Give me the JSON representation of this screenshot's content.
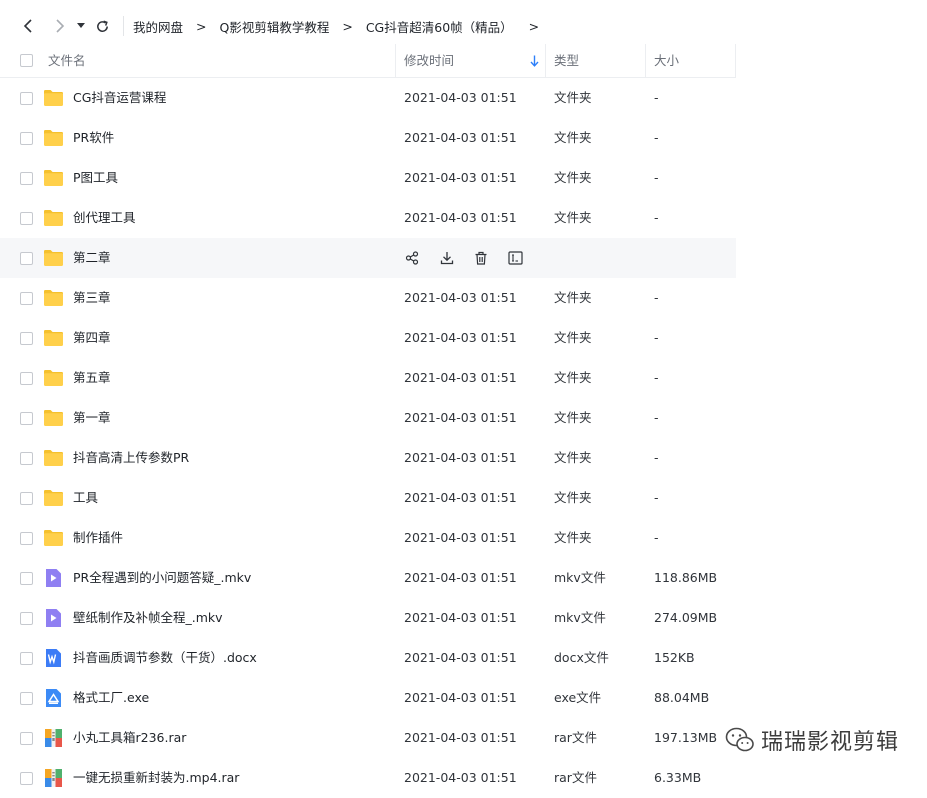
{
  "nav": {
    "back_icon": "chevron-left-icon",
    "forward_icon": "chevron-right-icon",
    "history_icon": "caret-down-icon",
    "refresh_icon": "refresh-icon"
  },
  "breadcrumb": [
    "我的网盘",
    "Q影视剪辑教学教程",
    "CG抖音超清60帧（精品）"
  ],
  "breadcrumb_separator": ">",
  "columns": {
    "name": "文件名",
    "date": "修改时间",
    "type": "类型",
    "size": "大小"
  },
  "sort": {
    "column": "date",
    "direction": "descending",
    "color": "#2d7ff9"
  },
  "files": [
    {
      "name": "CG抖音运营课程",
      "date": "2021-04-03 01:51",
      "type": "文件夹",
      "size": "-",
      "icon": "folder-icon"
    },
    {
      "name": "PR软件",
      "date": "2021-04-03 01:51",
      "type": "文件夹",
      "size": "-",
      "icon": "folder-icon"
    },
    {
      "name": "P图工具",
      "date": "2021-04-03 01:51",
      "type": "文件夹",
      "size": "-",
      "icon": "folder-icon"
    },
    {
      "name": "创代理工具",
      "date": "2021-04-03 01:51",
      "type": "文件夹",
      "size": "-",
      "icon": "folder-icon"
    },
    {
      "name": "第二章",
      "date": "",
      "type": "",
      "size": "",
      "icon": "folder-icon",
      "hover": true
    },
    {
      "name": "第三章",
      "date": "2021-04-03 01:51",
      "type": "文件夹",
      "size": "-",
      "icon": "folder-icon"
    },
    {
      "name": "第四章",
      "date": "2021-04-03 01:51",
      "type": "文件夹",
      "size": "-",
      "icon": "folder-icon"
    },
    {
      "name": "第五章",
      "date": "2021-04-03 01:51",
      "type": "文件夹",
      "size": "-",
      "icon": "folder-icon"
    },
    {
      "name": "第一章",
      "date": "2021-04-03 01:51",
      "type": "文件夹",
      "size": "-",
      "icon": "folder-icon"
    },
    {
      "name": "抖音高清上传参数PR",
      "date": "2021-04-03 01:51",
      "type": "文件夹",
      "size": "-",
      "icon": "folder-icon"
    },
    {
      "name": "工具",
      "date": "2021-04-03 01:51",
      "type": "文件夹",
      "size": "-",
      "icon": "folder-icon"
    },
    {
      "name": "制作插件",
      "date": "2021-04-03 01:51",
      "type": "文件夹",
      "size": "-",
      "icon": "folder-icon"
    },
    {
      "name": "PR全程遇到的小问题答疑_.mkv",
      "date": "2021-04-03 01:51",
      "type": "mkv文件",
      "size": "118.86MB",
      "icon": "video-file-icon"
    },
    {
      "name": "壁纸制作及补帧全程_.mkv",
      "date": "2021-04-03 01:51",
      "type": "mkv文件",
      "size": "274.09MB",
      "icon": "video-file-icon"
    },
    {
      "name": "抖音画质调节参数（干货）.docx",
      "date": "2021-04-03 01:51",
      "type": "docx文件",
      "size": "152KB",
      "icon": "word-file-icon"
    },
    {
      "name": "格式工厂.exe",
      "date": "2021-04-03 01:51",
      "type": "exe文件",
      "size": "88.04MB",
      "icon": "exe-file-icon"
    },
    {
      "name": "小丸工具箱r236.rar",
      "date": "2021-04-03 01:51",
      "type": "rar文件",
      "size": "197.13MB",
      "icon": "archive-file-icon"
    },
    {
      "name": "一键无损重新封装为.mp4.rar",
      "date": "2021-04-03 01:51",
      "type": "rar文件",
      "size": "6.33MB",
      "icon": "archive-file-icon"
    }
  ],
  "hover_actions": [
    "share-icon",
    "download-icon",
    "delete-icon",
    "rename-icon"
  ],
  "colors": {
    "folder": "#ffd04b",
    "folder_tab": "#f5c12e",
    "video": "#8f7ff2",
    "word": "#3c7cf6",
    "exe": "#3c8bf6",
    "archive_a": "#f5a623",
    "archive_b": "#4fb06d",
    "archive_c": "#e8574a",
    "archive_d": "#3a8be8"
  },
  "watermark": {
    "text": "瑞瑞影视剪辑",
    "icon": "wechat-icon"
  }
}
